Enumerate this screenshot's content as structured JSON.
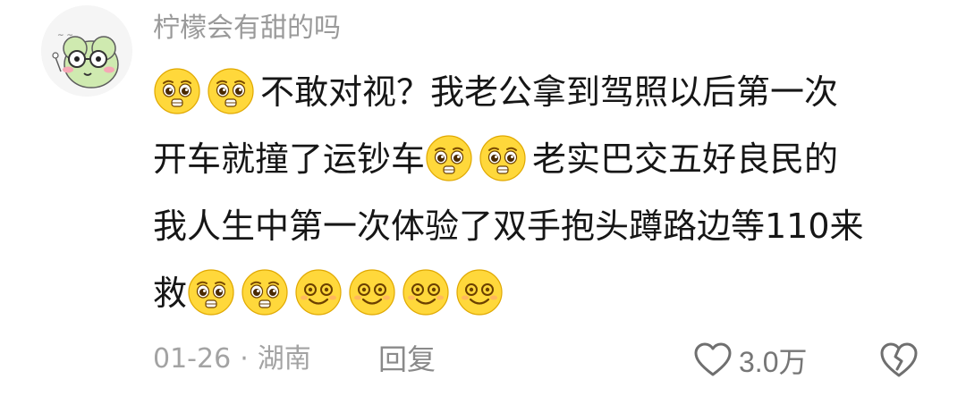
{
  "comment": {
    "username": "柠檬会有甜的吗",
    "lines": [
      [
        "emoji:pleading",
        "emoji:pleading",
        "不敢对视？我老公拿到驾照以后第一次"
      ],
      [
        "开车就撞了运钞车",
        "emoji:pleading",
        "emoji:pleading",
        "老实巴交五好良民的"
      ],
      [
        "我人生中第一次体验了双手抱头蹲路边等110来"
      ],
      [
        "救",
        "emoji:pleading",
        "emoji:pleading",
        "emoji:smile",
        "emoji:smile",
        "emoji:smile",
        "emoji:smile"
      ]
    ],
    "date": "01-26",
    "separator": "·",
    "location": "湖南",
    "reply_label": "回复",
    "like_count": "3.0万"
  },
  "icons": {
    "avatar": "frog-avatar-icon",
    "like": "heart-outline-icon",
    "dislike": "broken-heart-icon",
    "emoji_pleading": "pleading-face-icon",
    "emoji_smile": "smiling-face-icon"
  },
  "colors": {
    "username": "#9a9a9a",
    "text": "#161616",
    "meta": "#a3a3a3",
    "emoji_yellow": "#ffd83b"
  }
}
